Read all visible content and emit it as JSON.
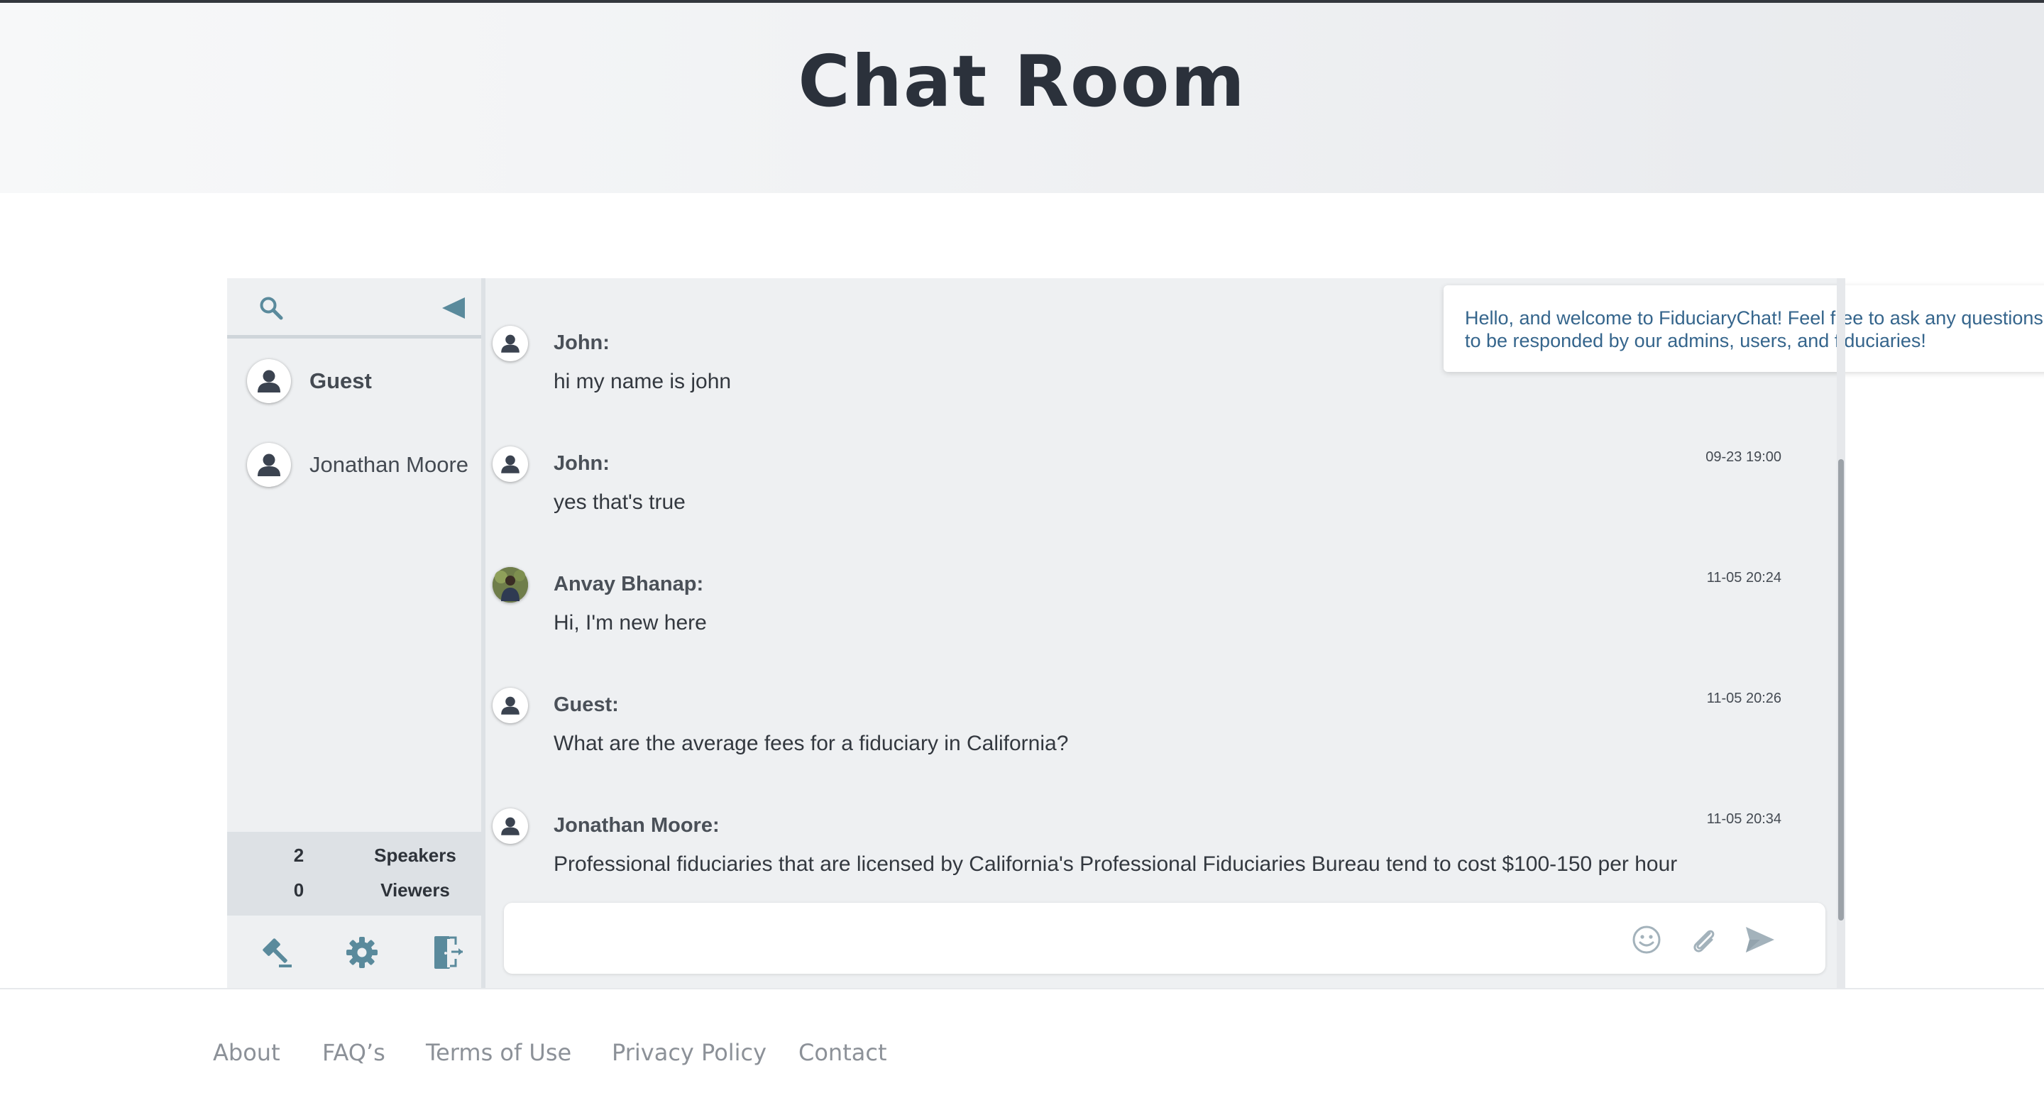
{
  "page": {
    "title": "Chat Room"
  },
  "sidebar": {
    "users": [
      {
        "name": "Guest",
        "current": true
      },
      {
        "name": "Jonathan Moore",
        "current": false
      }
    ],
    "stats": [
      {
        "count": "2",
        "label": "Speakers"
      },
      {
        "count": "0",
        "label": "Viewers"
      }
    ],
    "icons": [
      "search-icon",
      "collapse-triangle-icon",
      "gavel-icon",
      "gear-icon",
      "exit-door-icon"
    ]
  },
  "welcome": {
    "text": "Hello, and welcome to FiduciaryChat! Feel free to ask any questions to be responded by our admins, users, and fiduciaries!"
  },
  "messages": [
    {
      "author": "John:",
      "text": "hi my name is john",
      "time": ""
    },
    {
      "author": "John:",
      "text": "yes that's true",
      "time": "09-23 19:00"
    },
    {
      "author": "Anvay Bhanap:",
      "text": "Hi, I'm new here",
      "time": "11-05 20:24"
    },
    {
      "author": "Guest:",
      "text": "What are the average fees for a fiduciary in California?",
      "time": "11-05 20:26"
    },
    {
      "author": "Jonathan Moore:",
      "text": "Professional fiduciaries that are licensed by California's Professional Fiduciaries Bureau tend to cost $100-150 per hour",
      "time": "11-05 20:34"
    }
  ],
  "composer": {
    "value": "",
    "placeholder": ""
  },
  "footer": {
    "links": [
      "About",
      "FAQ’s",
      "Terms of Use",
      "Privacy Policy",
      "Contact"
    ]
  },
  "colors": {
    "accent": "#5a8a9c",
    "panel": "#eef0f2",
    "welcome_text": "#35658c"
  }
}
